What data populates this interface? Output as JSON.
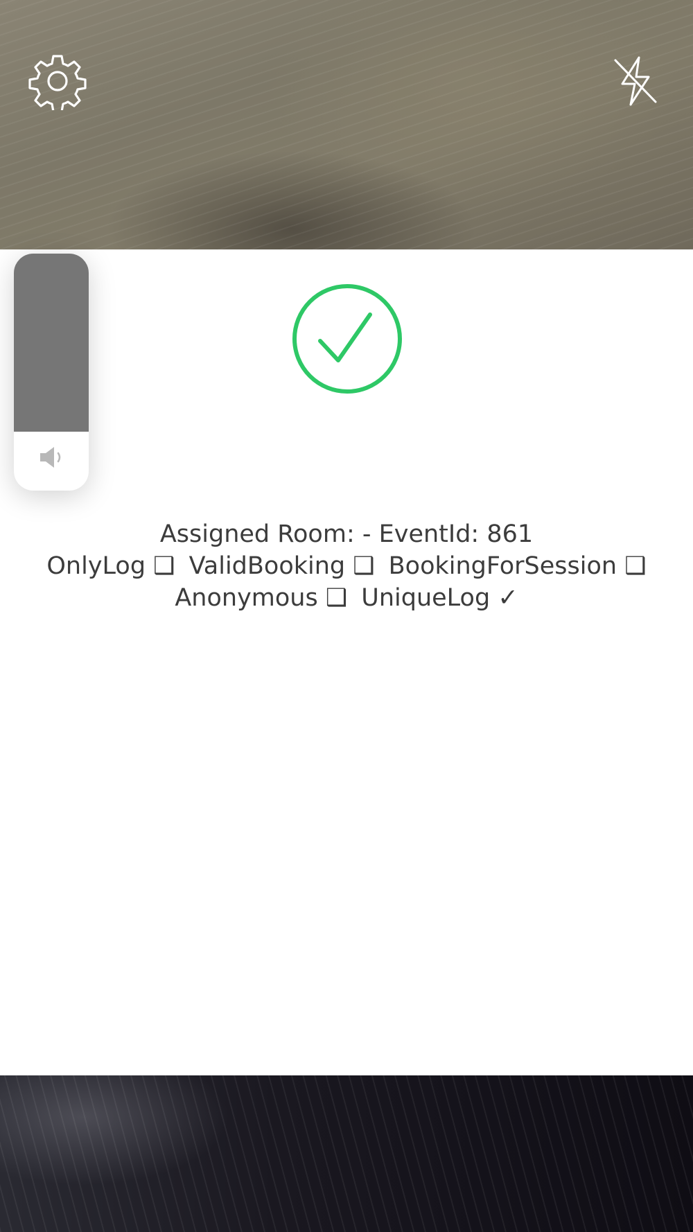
{
  "camera": {
    "settings_icon": "gear-icon",
    "flash_icon": "flash-off-icon"
  },
  "volume": {
    "level": 0.75,
    "icon": "speaker-icon",
    "fill_color": "#767676"
  },
  "result": {
    "status_icon": "check-circle-icon",
    "color": "#2ec866"
  },
  "info": {
    "assigned_room": "Assigned Room:  - EventId: 861",
    "flags_line1": [
      {
        "label": "OnlyLog ❑"
      },
      {
        "label": "ValidBooking ❑"
      },
      {
        "label": "BookingForSession ❑"
      }
    ],
    "flags_line2": [
      {
        "label": "Anonymous ❑"
      },
      {
        "label": "UniqueLog ✓"
      }
    ]
  }
}
